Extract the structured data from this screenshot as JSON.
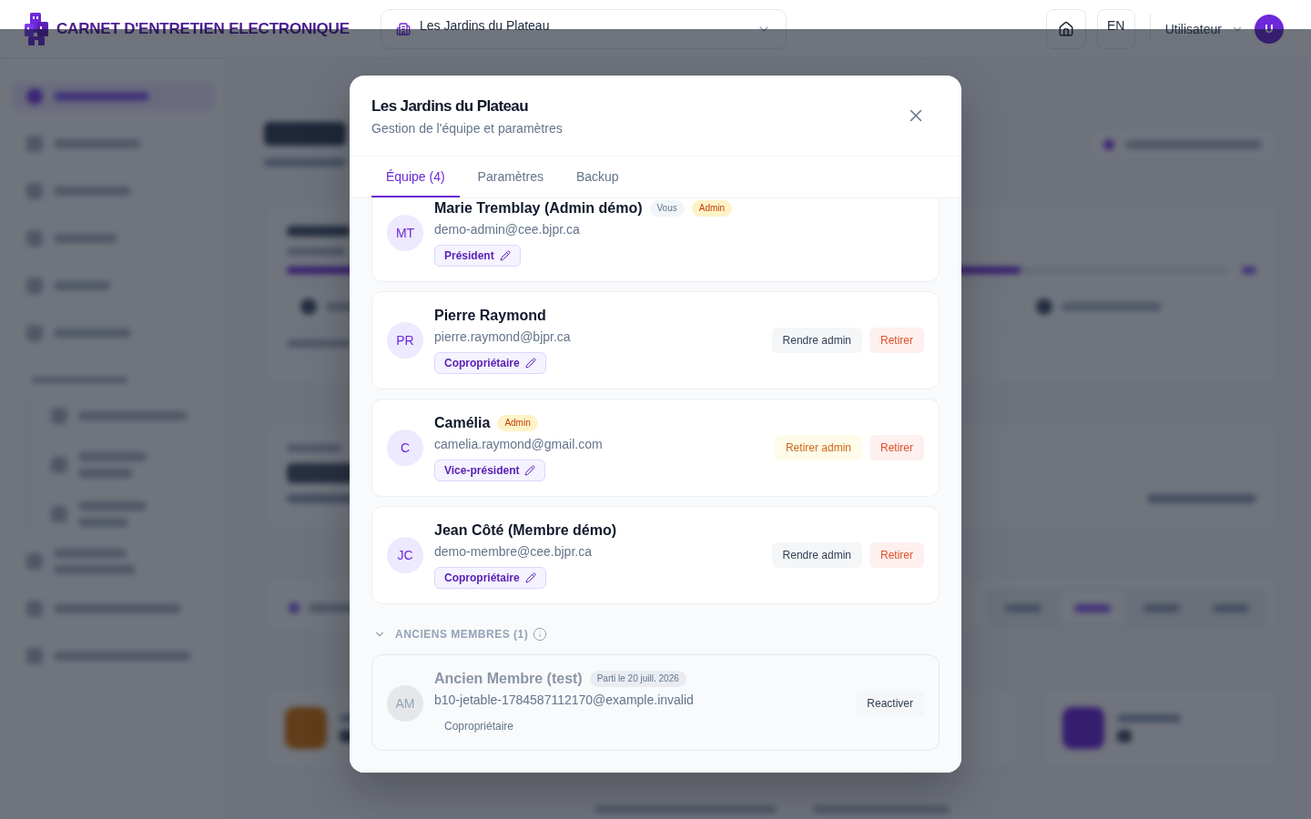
{
  "app_header": {
    "title": "CARNET D'ENTRETIEN ELECTRONIQUE",
    "building_selector": {
      "value": "Les Jardins du Plateau"
    },
    "language": "EN",
    "user": {
      "name": "Utilisateur",
      "initials": "U"
    }
  },
  "dashboard": {
    "progress": {
      "level": 0.78
    }
  },
  "dialog": {
    "title": "Les Jardins du Plateau",
    "subtitle": "Gestion de l'équipe et paramètres",
    "tabs": [
      {
        "label": "Équipe (4)",
        "selected": true
      },
      {
        "label": "Paramètres",
        "selected": false
      },
      {
        "label": "Backup",
        "selected": false
      }
    ],
    "members": [
      {
        "initials": "MT",
        "name": "Marie Tremblay (Admin démo)",
        "badges": [
          {
            "label": "Vous",
            "kind": "self"
          },
          {
            "label": "Admin",
            "kind": "admin"
          }
        ],
        "email": "demo-admin@cee.bjpr.ca",
        "role": {
          "label": "Président",
          "editable": true
        }
      },
      {
        "initials": "PR",
        "name": "Pierre Raymond",
        "email": "pierre.raymond@bjpr.ca",
        "role": {
          "label": "Copropriétaire",
          "editable": true
        },
        "actions": [
          {
            "label": "Rendre admin",
            "kind": "neutral"
          },
          {
            "label": "Retirer",
            "kind": "danger"
          }
        ]
      },
      {
        "initials": "C",
        "name": "Camélia",
        "badges": [
          {
            "label": "Admin",
            "kind": "admin"
          }
        ],
        "email": "camelia.raymond@gmail.com",
        "role": {
          "label": "Vice-président",
          "editable": true
        },
        "actions": [
          {
            "label": "Retirer admin",
            "kind": "warning"
          },
          {
            "label": "Retirer",
            "kind": "danger"
          }
        ]
      },
      {
        "initials": "JC",
        "name": "Jean Côté (Membre démo)",
        "email": "demo-membre@cee.bjpr.ca",
        "role": {
          "label": "Copropriétaire",
          "editable": true
        },
        "actions": [
          {
            "label": "Rendre admin",
            "kind": "neutral"
          },
          {
            "label": "Retirer",
            "kind": "danger"
          }
        ]
      }
    ],
    "former_members": {
      "title": "ANCIENS MEMBRES (1)",
      "expanded": true,
      "members": [
        {
          "initials": "AM",
          "name": "Ancien Membre (test)",
          "badges": [
            {
              "label": "Parti le 20 juill. 2026",
              "kind": "departed"
            }
          ],
          "email": "b10-jetable-1784587112170@example.invalid",
          "role": {
            "label": "Copropriétaire",
            "editable": false
          },
          "actions": [
            {
              "label": "Reactiver",
              "kind": "neutral"
            }
          ]
        }
      ]
    }
  }
}
